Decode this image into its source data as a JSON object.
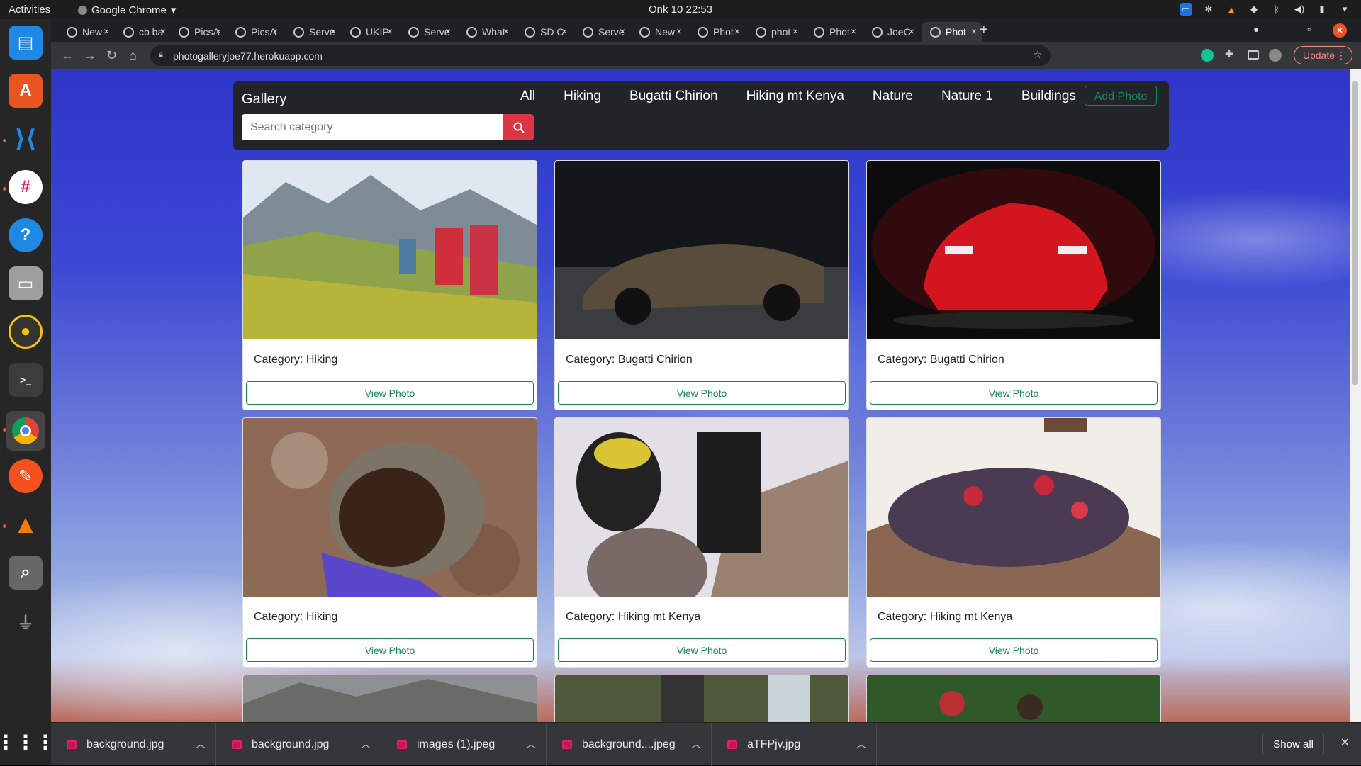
{
  "system": {
    "activities": "Activities",
    "app_name": "Google Chrome",
    "clock": "Onk 10  22:53"
  },
  "tabs": [
    "New",
    "cb ba",
    "PicsA",
    "PicsA",
    "Serve",
    "UKIP",
    "Serve",
    "What",
    "SD C",
    "Serve",
    "New",
    "Phot",
    "phot",
    "Phot",
    "JoeC",
    "Phot"
  ],
  "browser": {
    "url": "photogalleryjoe77.herokuapp.com",
    "update_label": "Update"
  },
  "site": {
    "brand": "Gallery",
    "nav_links": [
      "All",
      "Hiking",
      "Bugatti Chirion",
      "Hiking mt Kenya",
      "Nature",
      "Nature 1",
      "Buildings"
    ],
    "add_photo_label": "Add Photo",
    "search_placeholder": "Search category",
    "cards": [
      {
        "category": "Category: Hiking",
        "button": "View Photo",
        "scene": "hikers on a grassy mountain slope"
      },
      {
        "category": "Category: Bugatti Chirion",
        "button": "View Photo",
        "scene": "dark bronze bugatti on a road"
      },
      {
        "category": "Category: Bugatti Chirion",
        "button": "View Photo",
        "scene": "red bugatti on dark background"
      },
      {
        "category": "Category: Hiking",
        "button": "View Photo",
        "scene": "smiling man in beanie among rocks"
      },
      {
        "category": "Category: Hiking mt Kenya",
        "button": "View Photo",
        "scene": "two hikers on snowy rocks"
      },
      {
        "category": "Category: Hiking mt Kenya",
        "button": "View Photo",
        "scene": "group on a rocky summit"
      }
    ]
  },
  "downloads": {
    "items": [
      "background.jpg",
      "background.jpg",
      "images (1).jpeg",
      "background....jpeg",
      "aTFPjv.jpg"
    ],
    "show_all": "Show all"
  },
  "colors": {
    "accent_green": "#198754",
    "search_red": "#dc3545",
    "navbar": "#212529"
  }
}
